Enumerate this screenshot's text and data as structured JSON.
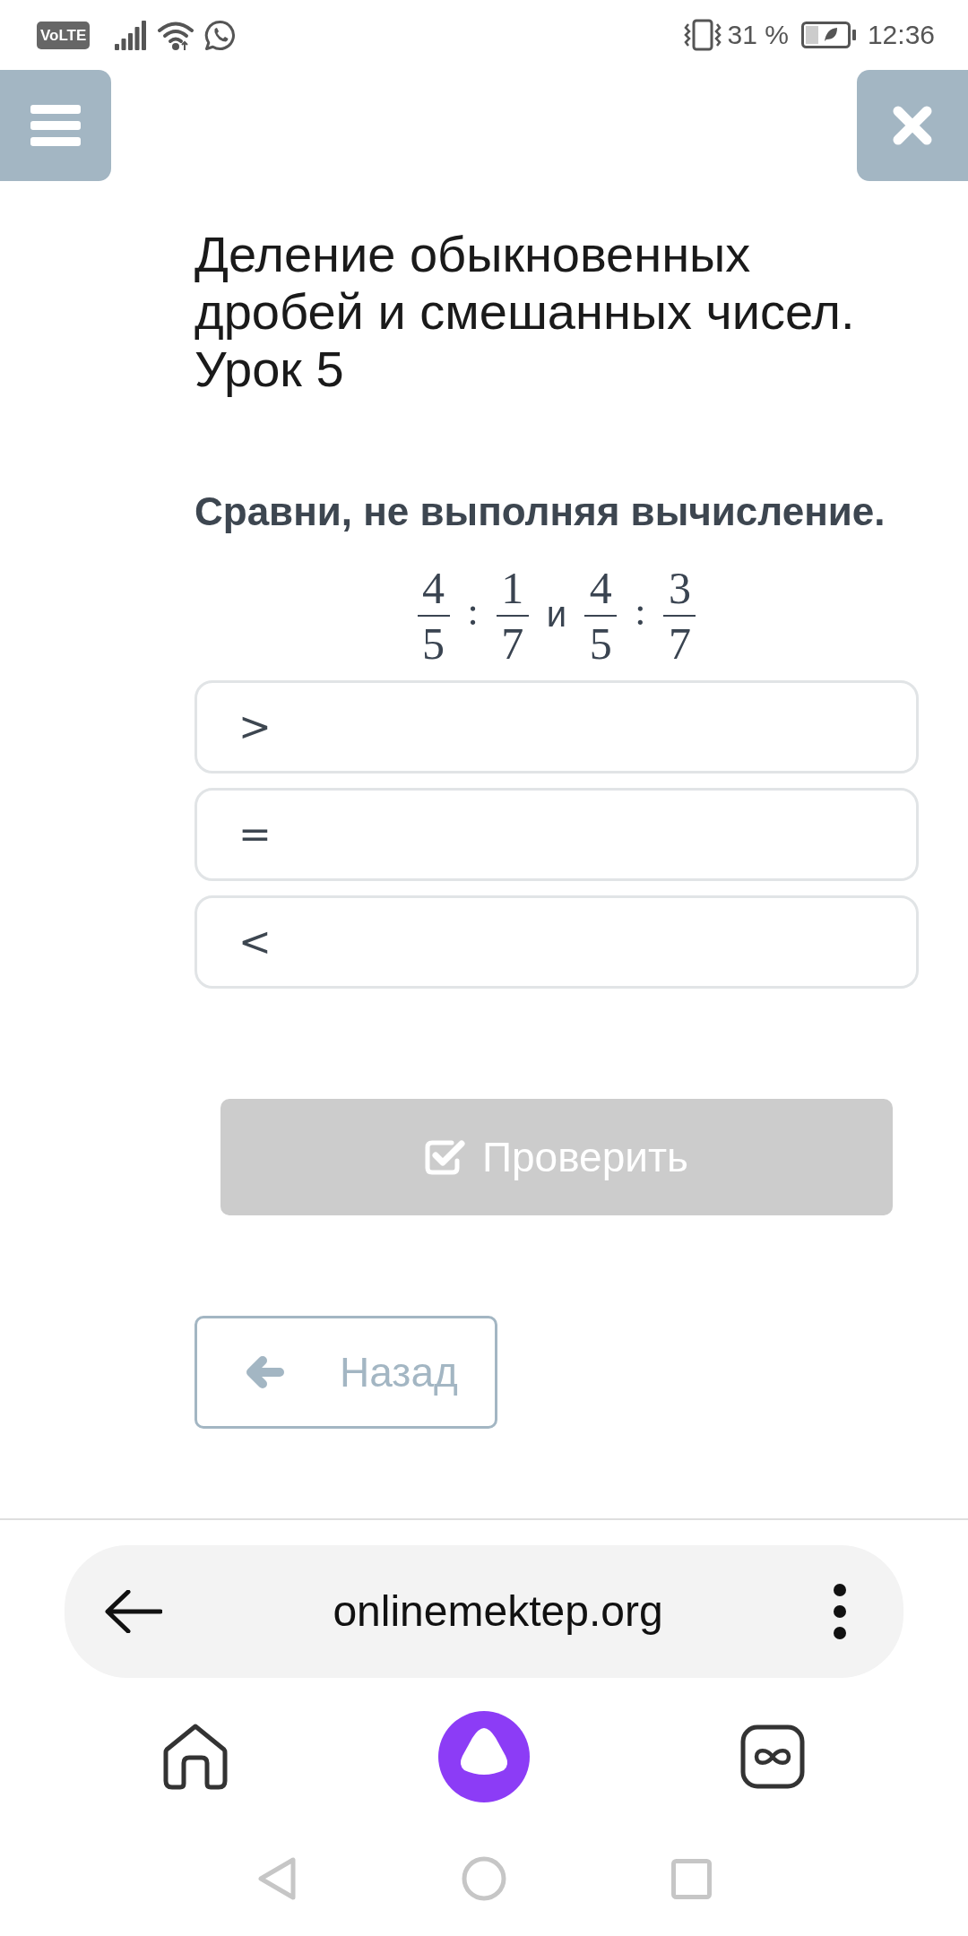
{
  "status_bar": {
    "network_badge": "VoLTE",
    "battery": "31 %",
    "time": "12:36"
  },
  "lesson": {
    "title": "Деление обыкновенных дробей и смешанных чисел. Урок 5"
  },
  "task": {
    "prompt": "Сравни, не выполняя вычисление.",
    "expression": [
      {
        "kind": "fraction",
        "numerator": "4",
        "denominator": "5"
      },
      {
        "kind": "operator",
        "text": ":"
      },
      {
        "kind": "fraction",
        "numerator": "1",
        "denominator": "7"
      },
      {
        "kind": "word",
        "text": "и"
      },
      {
        "kind": "fraction",
        "numerator": "4",
        "denominator": "5"
      },
      {
        "kind": "operator",
        "text": ":"
      },
      {
        "kind": "fraction",
        "numerator": "3",
        "denominator": "7"
      }
    ]
  },
  "options": [
    {
      "label": ">",
      "selected": false
    },
    {
      "label": "=",
      "selected": false
    },
    {
      "label": "<",
      "selected": false
    }
  ],
  "check_button": {
    "label": "Проверить",
    "disabled": true
  },
  "back_button": {
    "label": "Назад"
  },
  "browser": {
    "url": "onlinemektep.org"
  }
}
